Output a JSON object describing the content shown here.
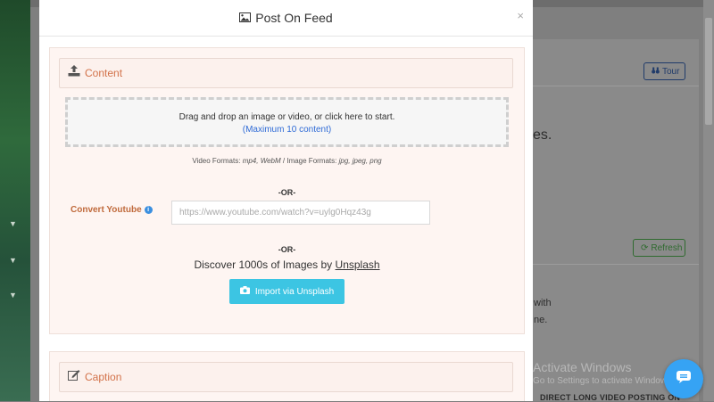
{
  "modal": {
    "title": "Post On Feed",
    "close": "×"
  },
  "content_section": {
    "label": "Content",
    "dropzone_text": "Drag and drop an image or video, or click here to start.",
    "dropzone_limit": "(Maximum 10 content)",
    "formats_video_label": "Video Formats:",
    "formats_video": "mp4, WebM",
    "formats_sep": " / ",
    "formats_image_label": "Image Formats:",
    "formats_image": "jpg, jpeg, png",
    "or_1": "-OR-",
    "youtube_label": "Convert Youtube",
    "youtube_placeholder": "https://www.youtube.com/watch?v=uylg0Hqz43g",
    "or_2": "-OR-",
    "discover_text": "Discover 1000s of Images by",
    "discover_link": "Unsplash",
    "import_button": "Import via Unsplash"
  },
  "caption_section": {
    "label": "Caption"
  },
  "background": {
    "tour_button": "Tour",
    "refresh_button": "Refresh",
    "partial_text_1": "es.",
    "partial_text_2": "with",
    "partial_text_3": "ne.",
    "bottom_text": "DIRECT LONG VIDEO POSTING ON",
    "watermark_title": "Activate Windows",
    "watermark_sub": "Go to Settings to activate Windows."
  },
  "colors": {
    "accent_orange": "#d2724a",
    "button_cyan": "#3cc5e3",
    "link_blue": "#2f6bd6",
    "chat_blue": "#36a3f4"
  }
}
